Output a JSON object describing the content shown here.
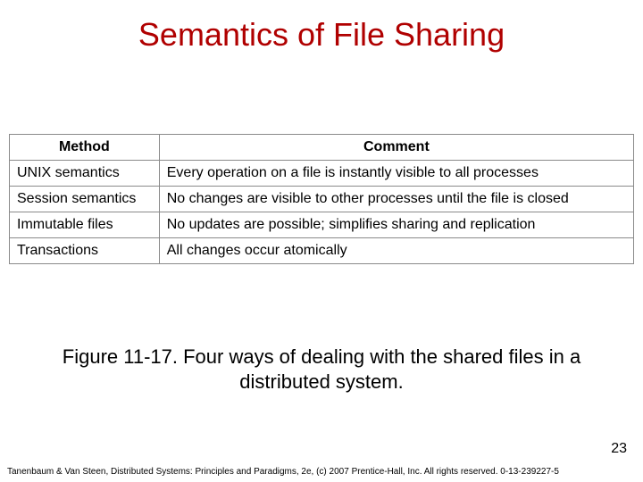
{
  "title": "Semantics of File Sharing",
  "table": {
    "headers": {
      "method": "Method",
      "comment": "Comment"
    },
    "rows": [
      {
        "method": "UNIX semantics",
        "comment": "Every operation on a file is instantly visible to all processes"
      },
      {
        "method": "Session semantics",
        "comment": "No changes are visible to other processes until the file is closed"
      },
      {
        "method": "Immutable files",
        "comment": "No updates are possible; simplifies sharing and replication"
      },
      {
        "method": "Transactions",
        "comment": "All changes occur atomically"
      }
    ]
  },
  "caption": "Figure 11-17. Four ways of dealing with the shared files in a distributed system.",
  "page_number": "23",
  "footer": "Tanenbaum & Van Steen, Distributed Systems: Principles and Paradigms, 2e, (c) 2007 Prentice-Hall, Inc. All rights reserved. 0-13-239227-5"
}
